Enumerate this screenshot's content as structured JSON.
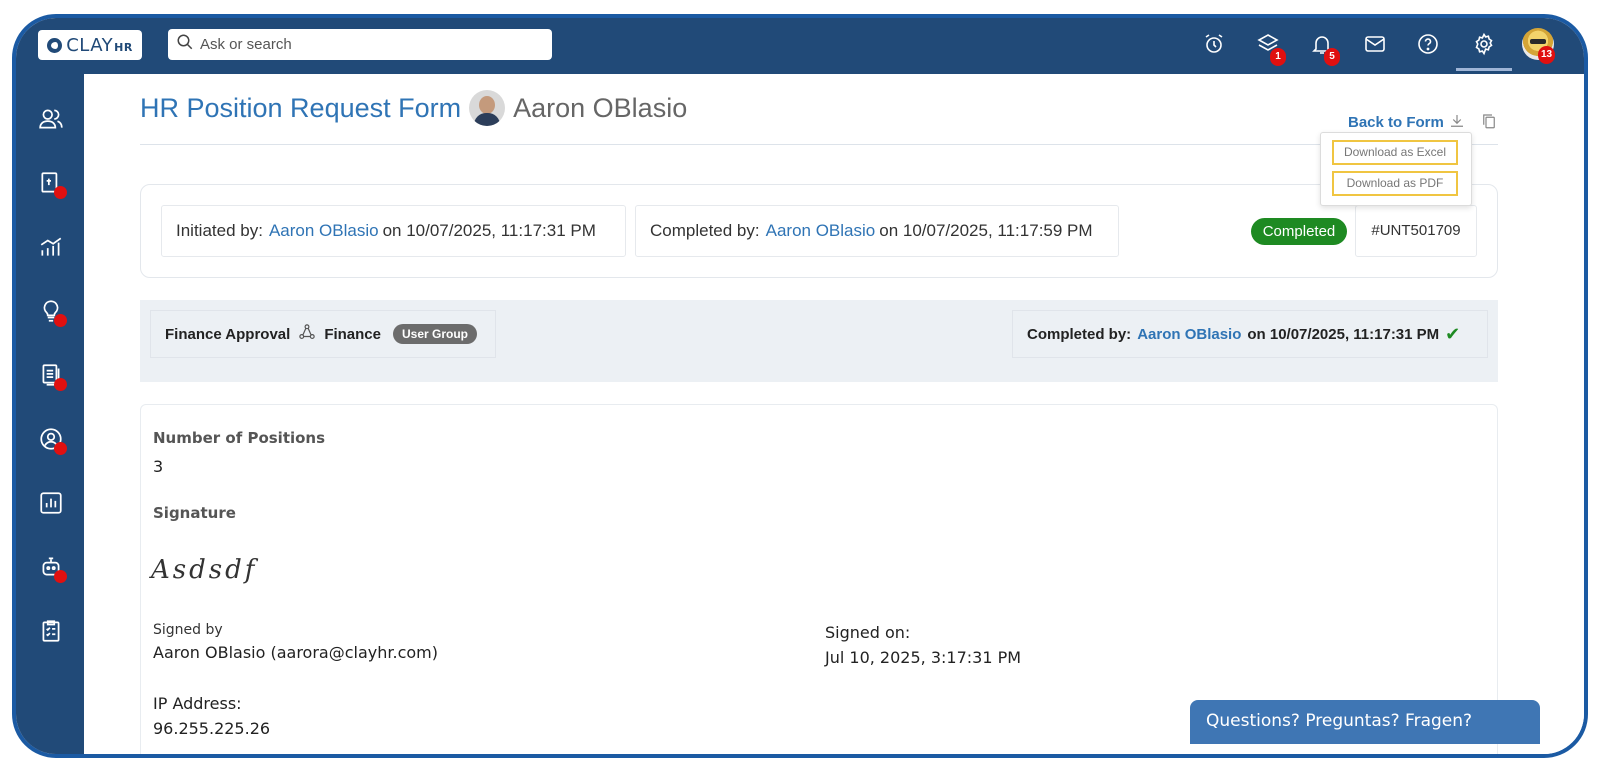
{
  "brand": {
    "logo_main": "CLAY",
    "logo_suffix": "HR"
  },
  "search": {
    "placeholder": "Ask or search"
  },
  "topbar": {
    "layers_badge": "1",
    "notifications_badge": "5",
    "avatar_badge": "13"
  },
  "page": {
    "title": "HR Position Request Form",
    "person_name": "Aaron OBlasio",
    "back_to_form": "Back to Form"
  },
  "download_menu": {
    "excel": "Download as Excel",
    "pdf": "Download as PDF"
  },
  "status": {
    "initiated_label": "Initiated by:",
    "initiated_by": "Aaron OBlasio",
    "initiated_on": "on 10/07/2025, 11:17:31 PM",
    "completed_label": "Completed by:",
    "completed_by": "Aaron OBlasio",
    "completed_on": "on 10/07/2025, 11:17:59 PM",
    "state": "Completed",
    "request_id": "#UNT501709"
  },
  "approval": {
    "step_name": "Finance Approval",
    "group_name": "Finance",
    "group_type": "User Group",
    "completed_label": "Completed by:",
    "completed_by": "Aaron OBlasio",
    "completed_on": "on 10/07/2025, 11:17:31 PM"
  },
  "form": {
    "positions_label": "Number of Positions",
    "positions_value": "3",
    "signature_label": "Signature",
    "signature_text": "Asdsdf",
    "signed_by_label": "Signed by",
    "signed_by_value": "Aaron OBlasio (aarora@clayhr.com)",
    "signed_on_label": "Signed on:",
    "signed_on_value": "Jul 10, 2025, 3:17:31 PM",
    "ip_label": "IP Address:",
    "ip_value": "96.255.225.26"
  },
  "chat": {
    "label": "Questions? Preguntas? Fragen?"
  },
  "colors": {
    "nav_bg": "#214a78",
    "link": "#2f74b5",
    "success": "#1e8a22",
    "badge": "#e01010",
    "highlight": "#f0c541"
  }
}
